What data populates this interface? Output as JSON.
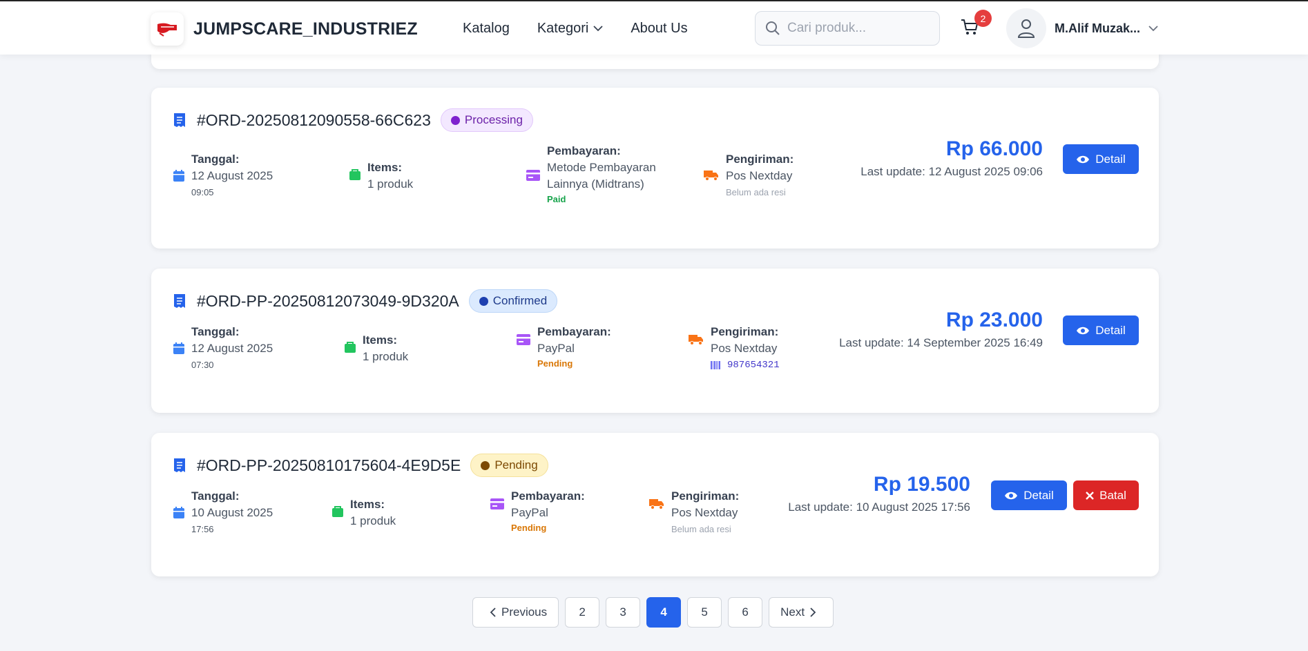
{
  "navbar": {
    "brand": "JUMPSCARE_INDUSTRIEZ",
    "links": [
      "Katalog",
      "Kategori",
      "About Us"
    ],
    "search_placeholder": "Cari produk...",
    "cart_count": "2",
    "user_name": "M.Alif Muzak..."
  },
  "labels": {
    "date": "Tanggal:",
    "items": "Items:",
    "payment": "Pembayaran:",
    "shipping": "Pengiriman:",
    "detail": "Detail",
    "cancel": "Batal"
  },
  "orders": [
    {
      "id": "#ORD-20250812090558-66C623",
      "status": "Processing",
      "date": "12 August 2025",
      "time": "09:05",
      "items": "1 produk",
      "payment_method_line1": "Metode Pembayaran",
      "payment_method_line2": "Lainnya (Midtrans)",
      "payment_status": "Paid",
      "shipping": "Pos Nextday",
      "shipping_note": "Belum ada resi",
      "price": "Rp 66.000",
      "last_update": "Last update: 12 August 2025 09:06"
    },
    {
      "id": "#ORD-PP-20250812073049-9D320A",
      "status": "Confirmed",
      "date": "12 August 2025",
      "time": "07:30",
      "items": "1 produk",
      "payment_method": "PayPal",
      "payment_status": "Pending",
      "shipping": "Pos Nextday",
      "tracking_number": "987654321",
      "price": "Rp 23.000",
      "last_update": "Last update: 14 September 2025 16:49"
    },
    {
      "id": "#ORD-PP-20250810175604-4E9D5E",
      "status": "Pending",
      "date": "10 August 2025",
      "time": "17:56",
      "items": "1 produk",
      "payment_method": "PayPal",
      "payment_status": "Pending",
      "shipping": "Pos Nextday",
      "shipping_note": "Belum ada resi",
      "price": "Rp 19.500",
      "last_update": "Last update: 10 August 2025 17:56"
    }
  ],
  "pagination": {
    "previous": "Previous",
    "next": "Next",
    "pages": [
      "2",
      "3",
      "4",
      "5",
      "6"
    ],
    "current": "4"
  },
  "colors": {
    "primary": "#2563eb",
    "danger": "#dc2626",
    "paid": "#16a34a",
    "pending": "#d97706"
  }
}
